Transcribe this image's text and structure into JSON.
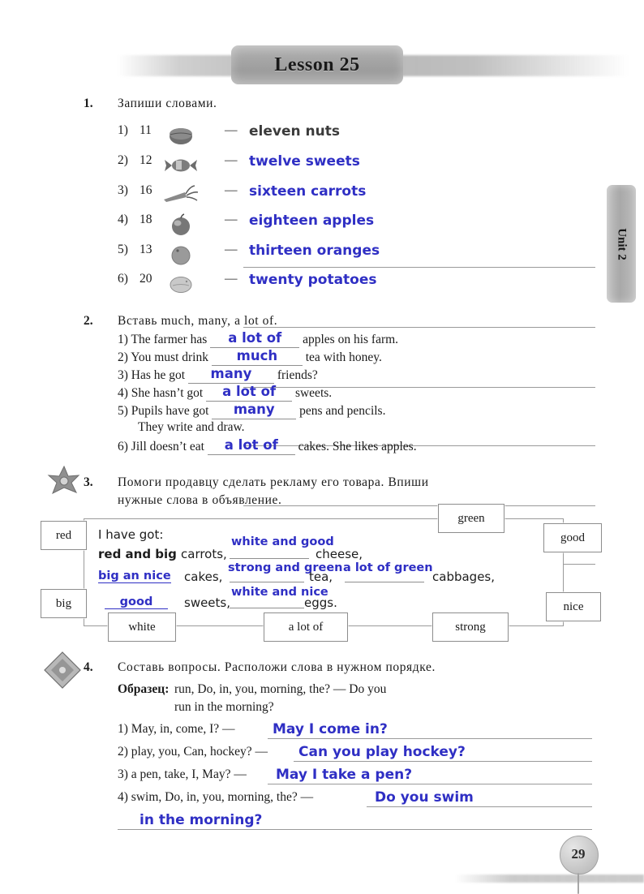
{
  "header": {
    "lesson_title": "Lesson 25",
    "unit_tab": "Unit 2",
    "page_number": "29"
  },
  "exercise1": {
    "number": "1.",
    "instruction": "Запиши словами.",
    "items": [
      {
        "index": "1)",
        "number": "11",
        "icon": "nut-icon",
        "dash": "—",
        "answer": "eleven  nuts",
        "ink": "pencil"
      },
      {
        "index": "2)",
        "number": "12",
        "icon": "candy-icon",
        "dash": "—",
        "answer": "twelve sweets",
        "ink": "blue"
      },
      {
        "index": "3)",
        "number": "16",
        "icon": "carrot-icon",
        "dash": "—",
        "answer": "sixteen carrots",
        "ink": "blue"
      },
      {
        "index": "4)",
        "number": "18",
        "icon": "apple-icon",
        "dash": "—",
        "answer": "eighteen apples",
        "ink": "blue"
      },
      {
        "index": "5)",
        "number": "13",
        "icon": "orange-icon",
        "dash": "—",
        "answer": "thirteen oranges",
        "ink": "blue"
      },
      {
        "index": "6)",
        "number": "20",
        "icon": "potato-icon",
        "dash": "—",
        "answer": "twenty potatoes",
        "ink": "blue"
      }
    ]
  },
  "exercise2": {
    "number": "2.",
    "instruction": "Вставь much, many, a lot of.",
    "items": [
      {
        "index": "1)",
        "before": "The  farmer  has",
        "answer": "a lot of",
        "after": "apples  on  his  farm."
      },
      {
        "index": "2)",
        "before": "You  must  drink",
        "answer": "much",
        "after": "tea  with  honey."
      },
      {
        "index": "3)",
        "before": "Has  he  got",
        "answer": "many",
        "after": "friends?"
      },
      {
        "index": "4)",
        "before": "She  hasn’t  got",
        "answer": "a lot of",
        "after": "sweets."
      },
      {
        "index": "5)",
        "before": "Pupils  have  got",
        "answer": "many",
        "after": "pens  and  pencils."
      },
      {
        "index": "6)",
        "before": "Jill  doesn’t  eat",
        "answer": "a lot of",
        "after": "cakes.  She  likes  apples."
      }
    ],
    "item5_continuation": "They  write  and  draw."
  },
  "exercise3": {
    "number": "3.",
    "instruction_line1": "Помоги продавцу сделать рекламу его товара. Впиши",
    "instruction_line2": "нужные слова в объявление.",
    "word_boxes": [
      {
        "label": "red",
        "position": "left-top"
      },
      {
        "label": "big",
        "position": "left-bottom"
      },
      {
        "label": "green",
        "position": "top-right"
      },
      {
        "label": "good",
        "position": "right-top"
      },
      {
        "label": "nice",
        "position": "right-bottom"
      },
      {
        "label": "white",
        "position": "bottom-left"
      },
      {
        "label": "a lot of",
        "position": "bottom-center"
      },
      {
        "label": "strong",
        "position": "bottom-right"
      }
    ],
    "ad": {
      "intro": "I  have  got:",
      "line1_bold": "red and big",
      "line1_noun": "carrots,",
      "line1_fill": "white and good",
      "line1_noun2": "cheese,",
      "line2_fill": "big an nice",
      "line2_noun": "cakes,",
      "line2_fill2": "strong and green",
      "line2_noun2": "tea,",
      "line2_fill3": "a lot of green",
      "line2_noun3": "cabbages,",
      "line3_fill": "good",
      "line3_noun": "sweets,",
      "line3_fill2": "white and nice",
      "line3_noun2": "eggs."
    }
  },
  "exercise4": {
    "number": "4.",
    "instruction": "Составь вопросы. Расположи слова в нужном порядке.",
    "sample_label": "Образец:",
    "sample_line1": "run, Do, in, you, morning, the?  —  Do  you",
    "sample_line2": "run  in  the  morning?",
    "items": [
      {
        "index": "1)",
        "prompt": "May,  in,  come,  I?  —",
        "answer": "May I come in?"
      },
      {
        "index": "2)",
        "prompt": "play,  you,  Can,  hockey?  —",
        "answer": "Can you play hockey?"
      },
      {
        "index": "3)",
        "prompt": "a pen,  take,  I,  May?  —",
        "answer": "May I take a pen?"
      },
      {
        "index": "4)",
        "prompt": "swim,  Do,  in,  you,  morning,  the?  —",
        "answer": "Do you swim",
        "answer_line2": "in the morning?"
      }
    ]
  },
  "colors": {
    "ink_blue": "#2f2fc4",
    "pencil_gray": "#3b3b3b",
    "rule_gray": "#9a9a9a",
    "banner_gray": "#a8a8a8"
  }
}
